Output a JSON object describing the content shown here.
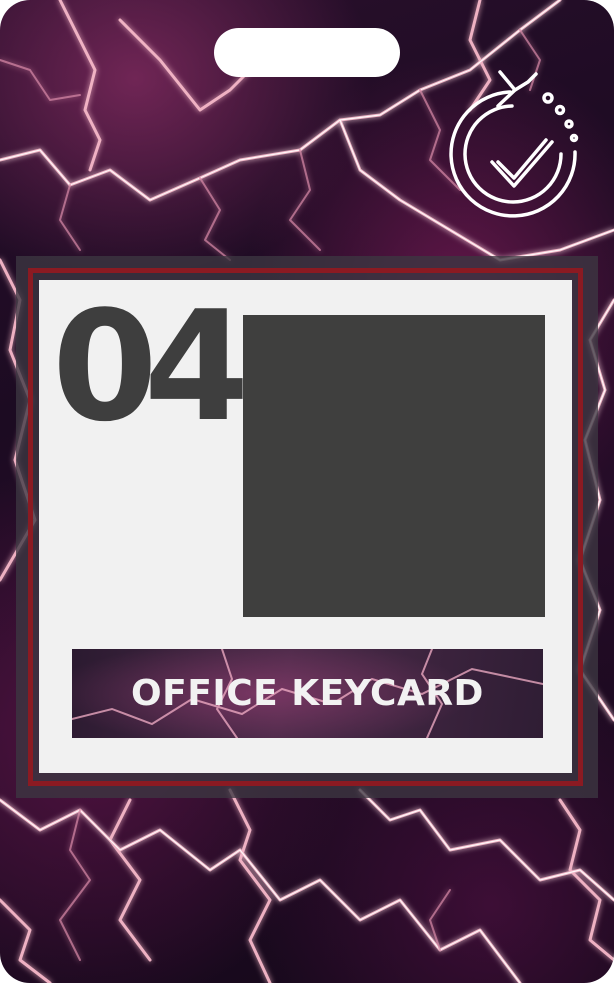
{
  "card": {
    "number": "04",
    "label": "OFFICE KEYCARD",
    "icon": "timer-check-icon",
    "colors": {
      "accent_red": "#8b1a22",
      "panel": "#f1f1f1",
      "text_dark": "#3e3e3e",
      "photo_placeholder": "#3f3f3e"
    }
  }
}
